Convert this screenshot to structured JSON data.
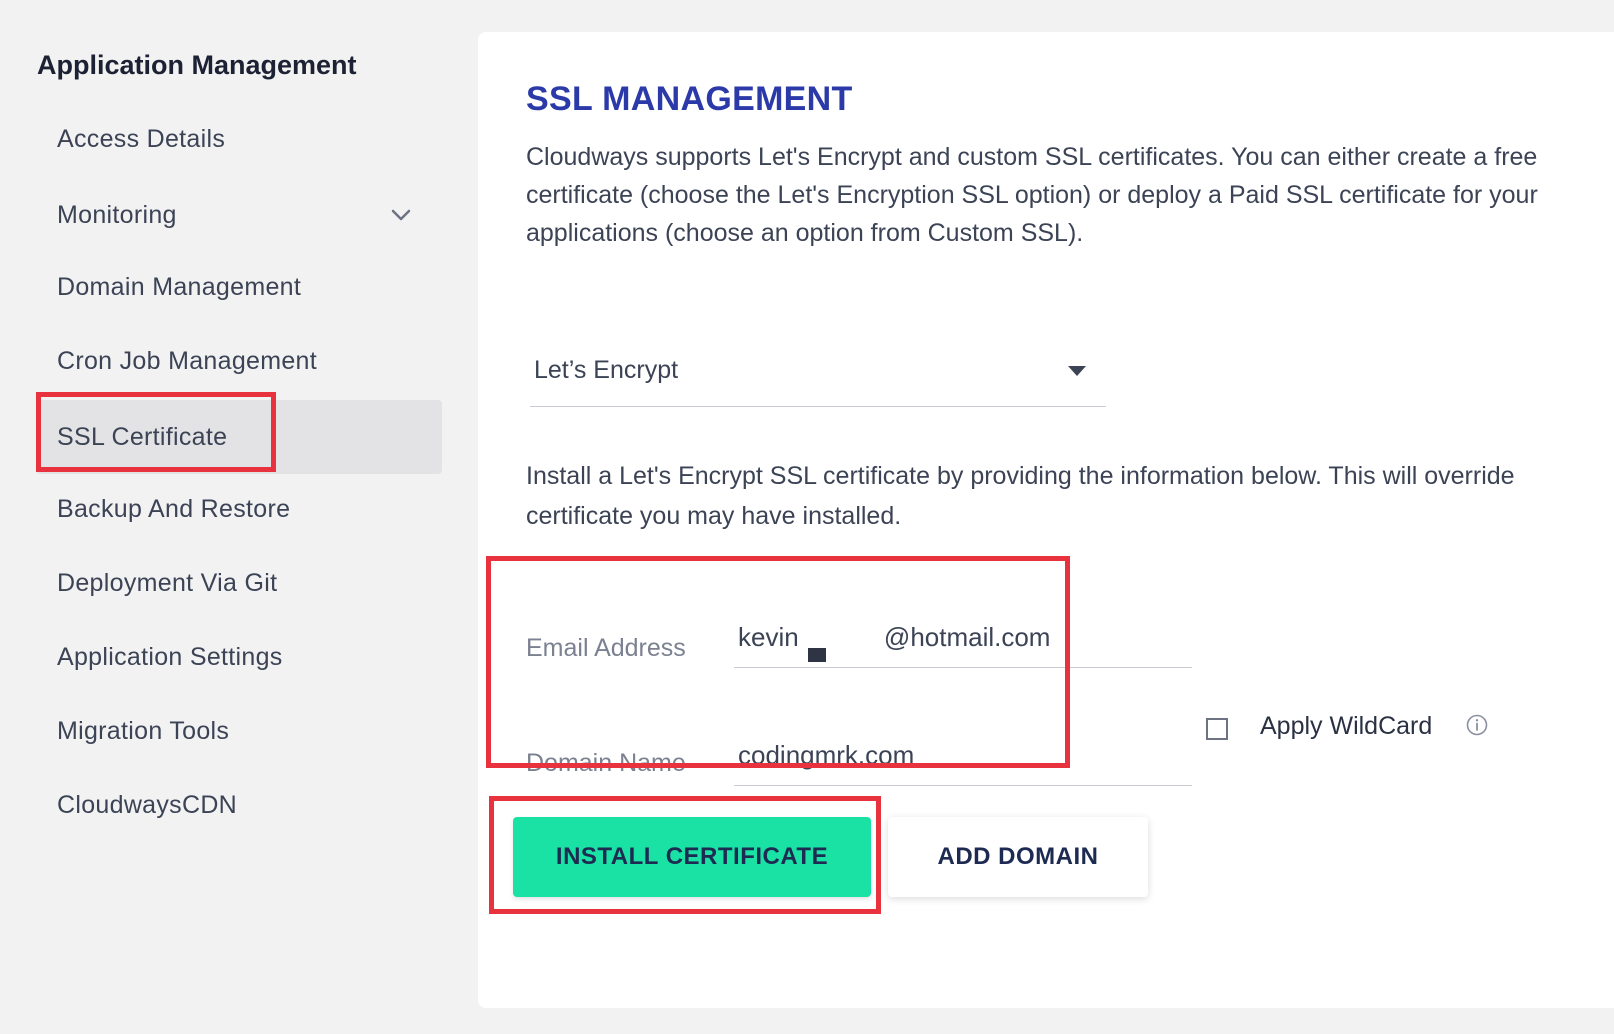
{
  "sidebar": {
    "title": "Application Management",
    "items": [
      {
        "label": "Access Details"
      },
      {
        "label": "Monitoring"
      },
      {
        "label": "Domain Management"
      },
      {
        "label": "Cron Job Management"
      },
      {
        "label": "SSL Certificate"
      },
      {
        "label": "Backup And Restore"
      },
      {
        "label": "Deployment Via Git"
      },
      {
        "label": "Application Settings"
      },
      {
        "label": "Migration Tools"
      },
      {
        "label": "CloudwaysCDN"
      }
    ]
  },
  "main": {
    "title": "SSL MANAGEMENT",
    "description_lines": [
      "Cloudways supports Let's Encrypt and custom SSL certificates. You can either create a free",
      "certificate (choose the Let's Encryption SSL option) or deploy a Paid SSL certificate for your",
      "applications (choose an option from Custom SSL)."
    ],
    "ssl_type_select": {
      "value": "Let’s Encrypt"
    },
    "install_note_lines": [
      "Install a Let's Encrypt SSL certificate by providing the information below. This will override",
      "certificate you may have installed."
    ],
    "email": {
      "label": "Email Address",
      "value": "kevin    @hotmail.com"
    },
    "domain": {
      "label": "Domain Name",
      "value": "codingmrk.com"
    },
    "wildcard": {
      "label": "Apply WildCard",
      "checked": false
    },
    "buttons": {
      "install": "INSTALL CERTIFICATE",
      "add_domain": "ADD DOMAIN"
    }
  },
  "colors": {
    "accent_title": "#2b3aa8",
    "install_button": "#1ae2a4",
    "highlight_box": "#e8333f",
    "active_nav": "#e3e3e5"
  }
}
